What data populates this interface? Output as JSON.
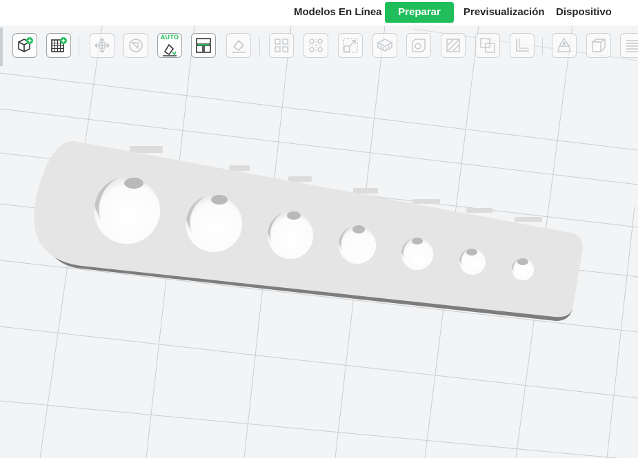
{
  "nav": {
    "tabs": [
      {
        "label": "Modelos En Línea",
        "active": false
      },
      {
        "label": "Preparar",
        "active": true
      },
      {
        "label": "Previsualización",
        "active": false
      },
      {
        "label": "Dispositivo",
        "active": false
      }
    ]
  },
  "toolbar": {
    "auto_label": "AUTO",
    "tools": [
      {
        "name": "add-object",
        "icon": "add-cube-icon",
        "enabled": true
      },
      {
        "name": "add-plate",
        "icon": "add-plate-icon",
        "enabled": true
      },
      {
        "name": "move",
        "icon": "move-icon",
        "enabled": false
      },
      {
        "name": "rotate",
        "icon": "rotate-icon",
        "enabled": false
      },
      {
        "name": "auto-orient",
        "icon": "auto-orient-icon",
        "enabled": true
      },
      {
        "name": "arrange",
        "icon": "arrange-icon",
        "enabled": true
      },
      {
        "name": "lay-on-face",
        "icon": "lay-on-face-icon",
        "enabled": false
      },
      {
        "name": "split-objects",
        "icon": "split-objects-icon",
        "enabled": false
      },
      {
        "name": "split-parts",
        "icon": "split-parts-icon",
        "enabled": false
      },
      {
        "name": "scale",
        "icon": "scale-icon",
        "enabled": false
      },
      {
        "name": "support-paint",
        "icon": "support-paint-icon",
        "enabled": false
      },
      {
        "name": "hollow",
        "icon": "hollow-icon",
        "enabled": false
      },
      {
        "name": "cut",
        "icon": "cut-icon",
        "enabled": false
      },
      {
        "name": "boolean",
        "icon": "boolean-icon",
        "enabled": false
      },
      {
        "name": "measure",
        "icon": "measure-icon",
        "enabled": false
      },
      {
        "name": "seam-paint",
        "icon": "seam-paint-icon",
        "enabled": false
      },
      {
        "name": "view-cube",
        "icon": "view-cube-icon",
        "enabled": false
      },
      {
        "name": "layers",
        "icon": "layers-icon",
        "enabled": false
      }
    ]
  },
  "model": {
    "name": "drill-gauge-plate",
    "hole_count": 7
  },
  "colors": {
    "accent": "#1fbe5a",
    "viewport_bg": "#f3f4f5",
    "model_face": "#e5e5e5",
    "grid_line": "#cacdd1"
  }
}
